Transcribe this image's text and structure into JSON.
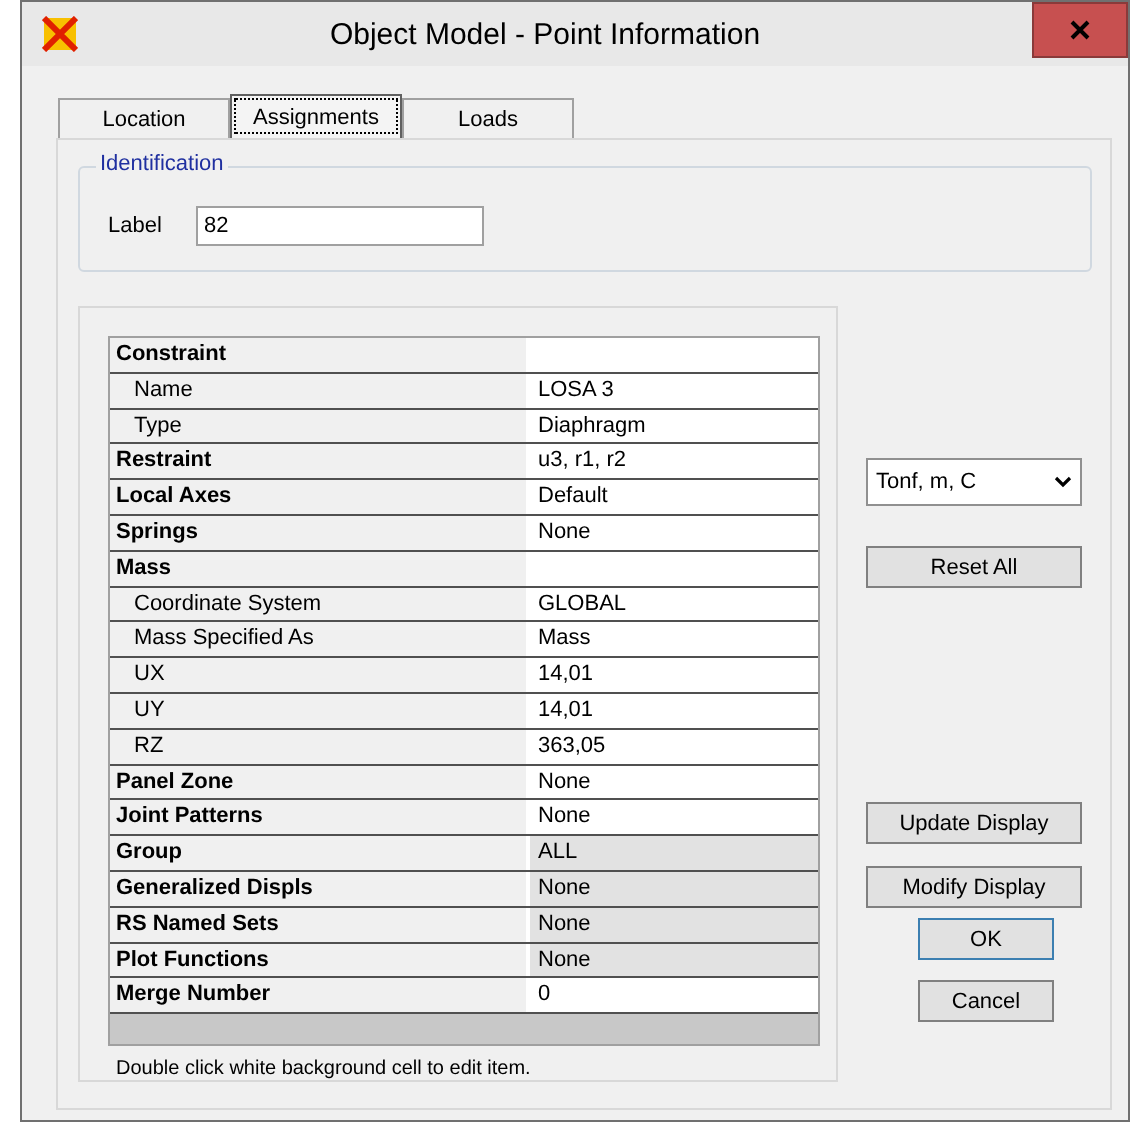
{
  "window": {
    "title": "Object Model - Point Information"
  },
  "tabs": [
    {
      "label": "Location",
      "selected": false
    },
    {
      "label": "Assignments",
      "selected": true
    },
    {
      "label": "Loads",
      "selected": false
    }
  ],
  "identification": {
    "title": "Identification",
    "label": "Label",
    "value": "82"
  },
  "grid": {
    "rows": [
      {
        "name": "Constraint",
        "children": [
          {
            "name": "Name",
            "value": "LOSA 3",
            "editable": true
          },
          {
            "name": "Type",
            "value": "Diaphragm",
            "editable": true
          }
        ]
      },
      {
        "name": "Restraint",
        "value": "u3, r1, r2",
        "editable": true
      },
      {
        "name": "Local Axes",
        "value": "Default",
        "editable": true
      },
      {
        "name": "Springs",
        "value": "None",
        "editable": true
      },
      {
        "name": "Mass",
        "children": [
          {
            "name": "Coordinate System",
            "value": "GLOBAL",
            "editable": true
          },
          {
            "name": "Mass Specified As",
            "value": "Mass",
            "editable": true
          },
          {
            "name": "UX",
            "value": "14,01",
            "editable": true
          },
          {
            "name": "UY",
            "value": "14,01",
            "editable": true
          },
          {
            "name": "RZ",
            "value": "363,05",
            "editable": true
          }
        ]
      },
      {
        "name": "Panel Zone",
        "value": "None",
        "editable": true
      },
      {
        "name": "Joint Patterns",
        "value": "None",
        "editable": true
      },
      {
        "name": "Group",
        "value": "ALL",
        "editable": false
      },
      {
        "name": "Generalized Displs",
        "value": "None",
        "editable": false
      },
      {
        "name": "RS Named Sets",
        "value": "None",
        "editable": false
      },
      {
        "name": "Plot Functions",
        "value": "None",
        "editable": false
      },
      {
        "name": "Merge Number",
        "value": "0",
        "editable": true
      }
    ],
    "hint": "Double click white background cell to edit item."
  },
  "units": {
    "value": "Tonf, m, C"
  },
  "buttons": {
    "reset": "Reset All",
    "update": "Update Display",
    "modify": "Modify Display",
    "ok": "OK",
    "cancel": "Cancel"
  }
}
